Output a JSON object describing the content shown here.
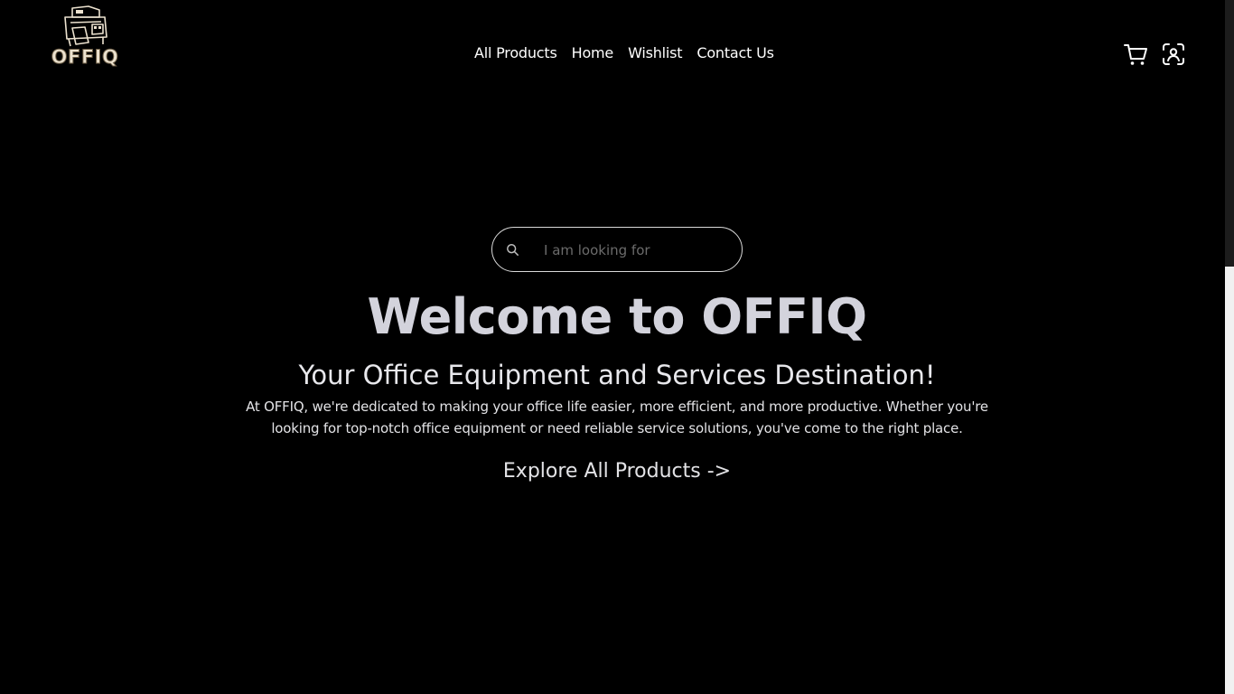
{
  "brand": {
    "logo_icon": "printer-logo-icon",
    "name": "OFFIQ"
  },
  "nav": {
    "items": [
      {
        "label": "All Products"
      },
      {
        "label": "Home"
      },
      {
        "label": "Wishlist"
      },
      {
        "label": "Contact Us"
      }
    ]
  },
  "header_icons": {
    "cart": "cart-icon",
    "account": "user-scan-icon"
  },
  "search": {
    "icon": "search-icon",
    "value": "",
    "placeholder": "I am looking for"
  },
  "hero": {
    "title": "Welcome to OFFIQ",
    "subtitle": "Your Office Equipment and Services Destination!",
    "description_line1": "At OFFIQ, we're dedicated to making your office life easier, more efficient, and more productive. Whether you're",
    "description_line2": "looking for top-notch office equipment or need reliable service solutions, you've come to the right place.",
    "cta": "Explore All Products ->"
  },
  "colors": {
    "background": "#000000",
    "title": "#d3d3dc",
    "text": "#ffffff",
    "placeholder": "#6b6b6b",
    "logo": "#ece2cf"
  }
}
